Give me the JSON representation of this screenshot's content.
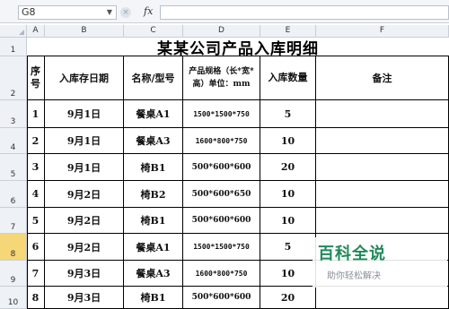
{
  "formula_bar": {
    "cell_ref": "G8",
    "fx": "fx",
    "cancel_symbol": "×"
  },
  "columns": [
    "A",
    "B",
    "C",
    "D",
    "E",
    "F"
  ],
  "rows": [
    "1",
    "2",
    "3",
    "4",
    "5",
    "6",
    "7",
    "8",
    "9",
    "10"
  ],
  "active_row": "8",
  "sheet": {
    "title": "某某公司产品入库明细",
    "headers": {
      "seq": "序号",
      "date": "入库存日期",
      "name": "名称/型号",
      "spec": "产品规格（长*宽*高）单位：mm",
      "qty": "入库数量",
      "note": "备注"
    },
    "records": [
      {
        "seq": "1",
        "date": "9月1日",
        "name": "餐桌A1",
        "spec": "1500*1500*750",
        "qty": "5",
        "note": ""
      },
      {
        "seq": "2",
        "date": "9月1日",
        "name": "餐桌A3",
        "spec": "1600*800*750",
        "qty": "10",
        "note": ""
      },
      {
        "seq": "3",
        "date": "9月1日",
        "name": "椅B1",
        "spec": "500*600*600",
        "qty": "20",
        "note": ""
      },
      {
        "seq": "4",
        "date": "9月2日",
        "name": "椅B2",
        "spec": "500*600*650",
        "qty": "10",
        "note": ""
      },
      {
        "seq": "5",
        "date": "9月2日",
        "name": "椅B1",
        "spec": "500*600*600",
        "qty": "10",
        "note": ""
      },
      {
        "seq": "6",
        "date": "9月2日",
        "name": "餐桌A1",
        "spec": "1500*1500*750",
        "qty": "5",
        "note": ""
      },
      {
        "seq": "7",
        "date": "9月3日",
        "name": "餐桌A3",
        "spec": "1600*800*750",
        "qty": "10",
        "note": ""
      },
      {
        "seq": "8",
        "date": "9月3日",
        "name": "椅B1",
        "spec": "500*600*600",
        "qty": "20",
        "note": ""
      }
    ]
  },
  "watermark": {
    "title": "百科全说",
    "subtitle": "助你轻松解决"
  }
}
